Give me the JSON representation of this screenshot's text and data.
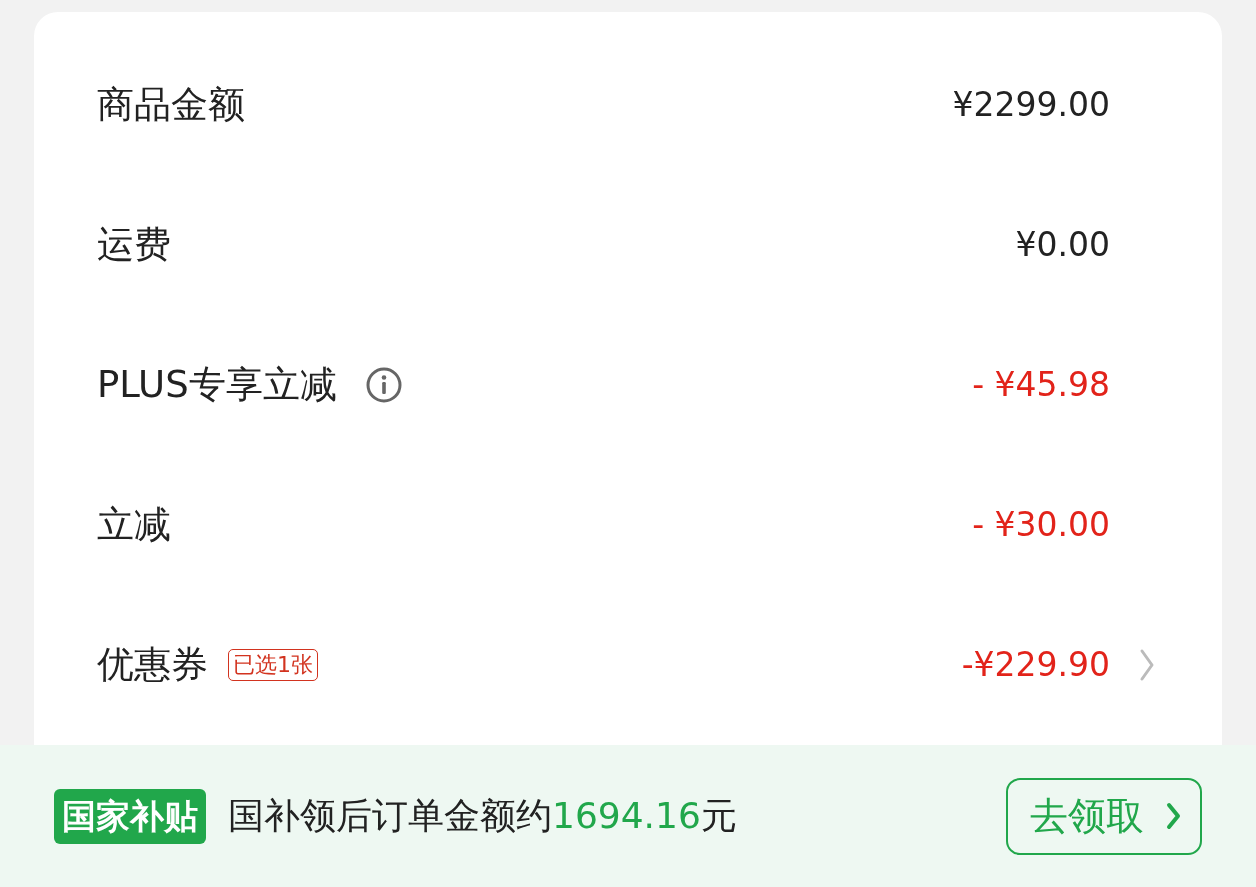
{
  "rows": [
    {
      "label": "商品金额",
      "value": "¥2299.00",
      "kind": "normal",
      "info": false,
      "chevron": false
    },
    {
      "label": "运费",
      "value": "¥0.00",
      "kind": "normal",
      "info": false,
      "chevron": false
    },
    {
      "label": "PLUS专享立减",
      "value": "- ¥45.98",
      "kind": "discount",
      "info": true,
      "chevron": false
    },
    {
      "label": "立减",
      "value": "- ¥30.00",
      "kind": "discount",
      "info": false,
      "chevron": false
    },
    {
      "label": "优惠券",
      "tag": "已选1张",
      "value": "-¥229.90",
      "kind": "discount",
      "info": false,
      "chevron": true
    }
  ],
  "subsidy": {
    "badge": "国家补贴",
    "text_before": "国补领后订单金额约",
    "amount": "1694.16",
    "text_after": "元",
    "button": "去领取"
  }
}
